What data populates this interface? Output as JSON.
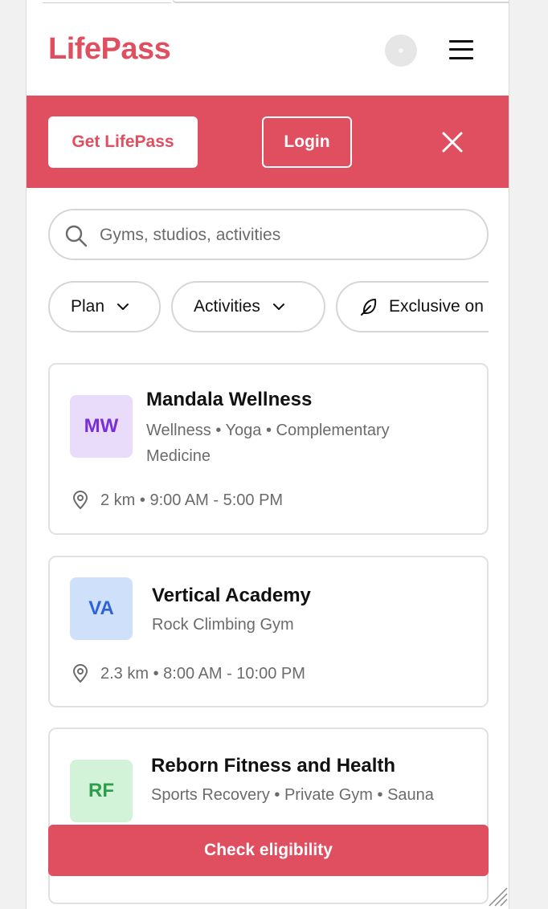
{
  "header": {
    "logo": "LifePass"
  },
  "banner": {
    "get_label": "Get LifePass",
    "login_label": "Login"
  },
  "search": {
    "placeholder": "Gyms, studios, activities"
  },
  "filters": [
    {
      "label": "Plan"
    },
    {
      "label": "Activities"
    },
    {
      "label": "Exclusive on"
    }
  ],
  "venues": [
    {
      "initials": "MW",
      "name": "Mandala Wellness",
      "categories": "Wellness • Yoga • Complementary Medicine",
      "meta": "2 km • 9:00 AM - 5:00 PM",
      "badge_bg": "#e9dcfb",
      "badge_fg": "#7a2fd6"
    },
    {
      "initials": "VA",
      "name": "Vertical Academy",
      "categories": "Rock Climbing Gym",
      "meta": "2.3 km • 8:00 AM - 10:00 PM",
      "badge_bg": "#cfe0fb",
      "badge_fg": "#2f62d6"
    },
    {
      "initials": "RF",
      "name": "Reborn Fitness and Health",
      "categories": "Sports Recovery • Private Gym • Sauna",
      "badge_bg": "#d3f3d8",
      "badge_fg": "#2f9e4a"
    }
  ],
  "cta": {
    "label": "Check eligibility"
  },
  "colors": {
    "brand": "#e04f60"
  }
}
